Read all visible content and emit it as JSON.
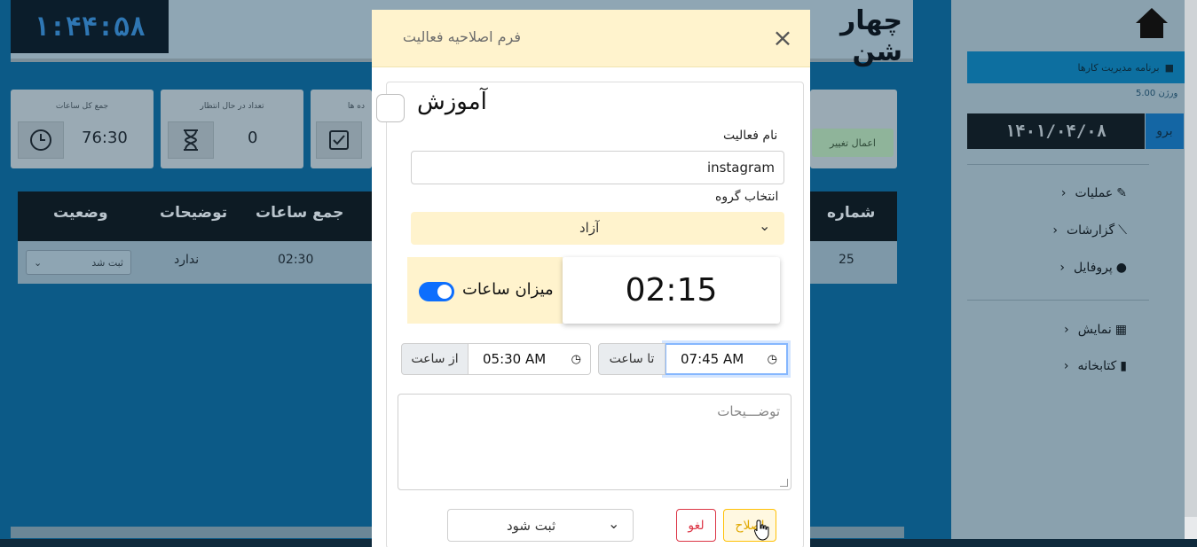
{
  "background": {
    "clock": "۱:۴۴:۵۸",
    "day_name": "چهار شن",
    "cards": [
      {
        "title": "جمع کل ساعات",
        "value": "76:30",
        "icon": "clock-icon"
      },
      {
        "title": "تعداد در حال انتظار",
        "value": "0",
        "icon": "hourglass-icon"
      },
      {
        "title": "ده ها",
        "icon": "check-square-icon"
      }
    ],
    "apply_changes_label": "اعمال تغییر",
    "table": {
      "headers": [
        "شماره",
        "جمع ساعات",
        "توضیحات",
        "وضعیت"
      ],
      "row": {
        "number": "25",
        "total_hours": "02:30",
        "description": "ندارد",
        "status": "ثبت شد"
      }
    }
  },
  "sidebar": {
    "banner": "برنامه مدیریت کارها",
    "version": "ورژن 5.00",
    "date": "۱۴۰۱/۰۴/۰۸",
    "go_button": "برو",
    "items": [
      {
        "label": "عملیات",
        "icon": "edit-icon"
      },
      {
        "label": "گزارشات",
        "icon": "chart-icon"
      },
      {
        "label": "پروفایل",
        "icon": "user-icon"
      },
      {
        "label": "نمایش",
        "icon": "table-icon"
      },
      {
        "label": "کتابخانه",
        "icon": "book-icon"
      }
    ]
  },
  "modal": {
    "title": "فرم اصلاحیه فعالیت",
    "category_label": "آموزش",
    "activity_name_label": "نام فعالیت",
    "activity_name_value": "instagram",
    "group_label": "انتخاب گروه",
    "group_value": "آزاد",
    "toggle_label": "میزان ساعات",
    "duration": "02:15",
    "to_label": "تا ساعت",
    "to_value": "07:45 AM",
    "from_label": "از ساعت",
    "from_value": "05:30 AM",
    "description_placeholder": "توضـــیحات",
    "status_value": "ثبت شود",
    "cancel_label": "لغو",
    "edit_label": "اصلاح"
  },
  "colors": {
    "modal_header": "#fff3cd",
    "toggle_on": "#0d6efd",
    "cancel": "#dc3545",
    "edit": "#ffc107"
  }
}
